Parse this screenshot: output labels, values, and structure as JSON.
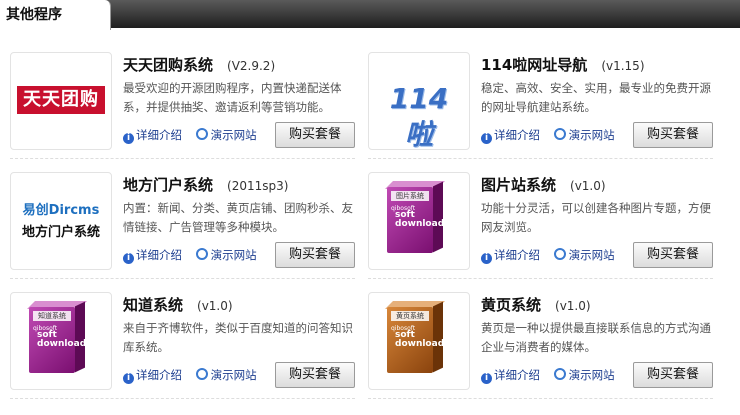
{
  "header": {
    "tab_title": "其他程序"
  },
  "programs": [
    {
      "title": "天天团购系统",
      "version": "(V2.9.2)",
      "description": "最受欢迎的开源团购程序，内置快递配送体系，并提供抽奖、邀请返利等营销功能。",
      "logo_text": "天天团购",
      "detail_label": "详细介绍",
      "demo_label": "演示网站",
      "buy_label": "购买套餐"
    },
    {
      "title": "114啦网址导航",
      "version": "(v1.15)",
      "description": "稳定、高效、安全、实用，最专业的免费开源的网址导航建站系统。",
      "logo_text": "114啦",
      "detail_label": "详细介绍",
      "demo_label": "演示网站",
      "buy_label": "购买套餐"
    },
    {
      "title": "地方门户系统",
      "version": "(2011sp3)",
      "description": "内置：新闻、分类、黄页店铺、团购秒杀、友情链接、广告管理等多种模块。",
      "logo_text_top": "易创Dircms",
      "logo_text_bottom": "地方门户系统",
      "detail_label": "详细介绍",
      "demo_label": "演示网站",
      "buy_label": "购买套餐"
    },
    {
      "title": "图片站系统",
      "version": "(v1.0)",
      "description": "功能十分灵活，可以创建各种图片专题，方便网友浏览。",
      "box_label": "图片系统",
      "box_brand": "qibosoft",
      "box_text": "soft download",
      "detail_label": "详细介绍",
      "demo_label": "演示网站",
      "buy_label": "购买套餐"
    },
    {
      "title": "知道系统",
      "version": "(v1.0)",
      "description": "来自于齐博软件，类似于百度知道的问答知识库系统。",
      "box_label": "知道系统",
      "box_brand": "qibosoft",
      "box_text": "soft download",
      "detail_label": "详细介绍",
      "demo_label": "演示网站",
      "buy_label": "购买套餐"
    },
    {
      "title": "黄页系统",
      "version": "(v1.0)",
      "description": "黄页是一种以提供最直接联系信息的方式沟通企业与消费者的媒体。",
      "box_label": "黄页系统",
      "box_brand": "qibosoft",
      "box_text": "soft download",
      "detail_label": "详细介绍",
      "demo_label": "演示网站",
      "buy_label": "购买套餐"
    }
  ],
  "colors": {
    "link": "#1c3d8f",
    "tuan_red": "#c8102e",
    "box_purple": "#9b1c8e",
    "box_orange": "#b8631a"
  }
}
